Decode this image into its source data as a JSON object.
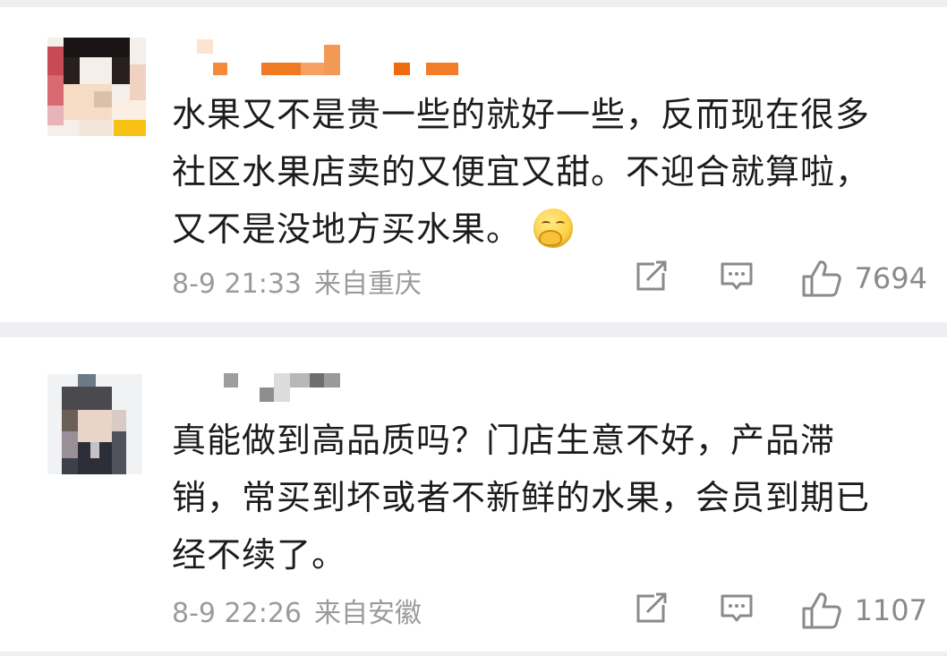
{
  "comments": [
    {
      "text_lines": [
        "水果又不是贵一些的就好一些，反而现在很多",
        "社区水果店卖的又便宜又甜。不迎合就算啦，",
        "又不是没地方买水果。"
      ],
      "emoji_icon": "smirk-emoji-icon",
      "date": "8-9 21:33",
      "location": "来自重庆",
      "likes": "7694"
    },
    {
      "text_lines": [
        "真能做到高品质吗？门店生意不好，产品滞",
        "销，常买到坏或者不新鲜的水果，会员到期已",
        "经不续了。"
      ],
      "date": "8-9 22:26",
      "location": "来自安徽",
      "likes": "1107"
    }
  ],
  "icons": {
    "repost": "repost-icon",
    "comment": "comment-icon",
    "like": "thumbs-up-icon"
  },
  "colors": {
    "background": "#efeff1",
    "card": "#ffffff",
    "text": "#1c1c1c",
    "meta": "#9b9b9b",
    "icon": "#8a8a8a",
    "username_pixel": "#f0701a"
  }
}
